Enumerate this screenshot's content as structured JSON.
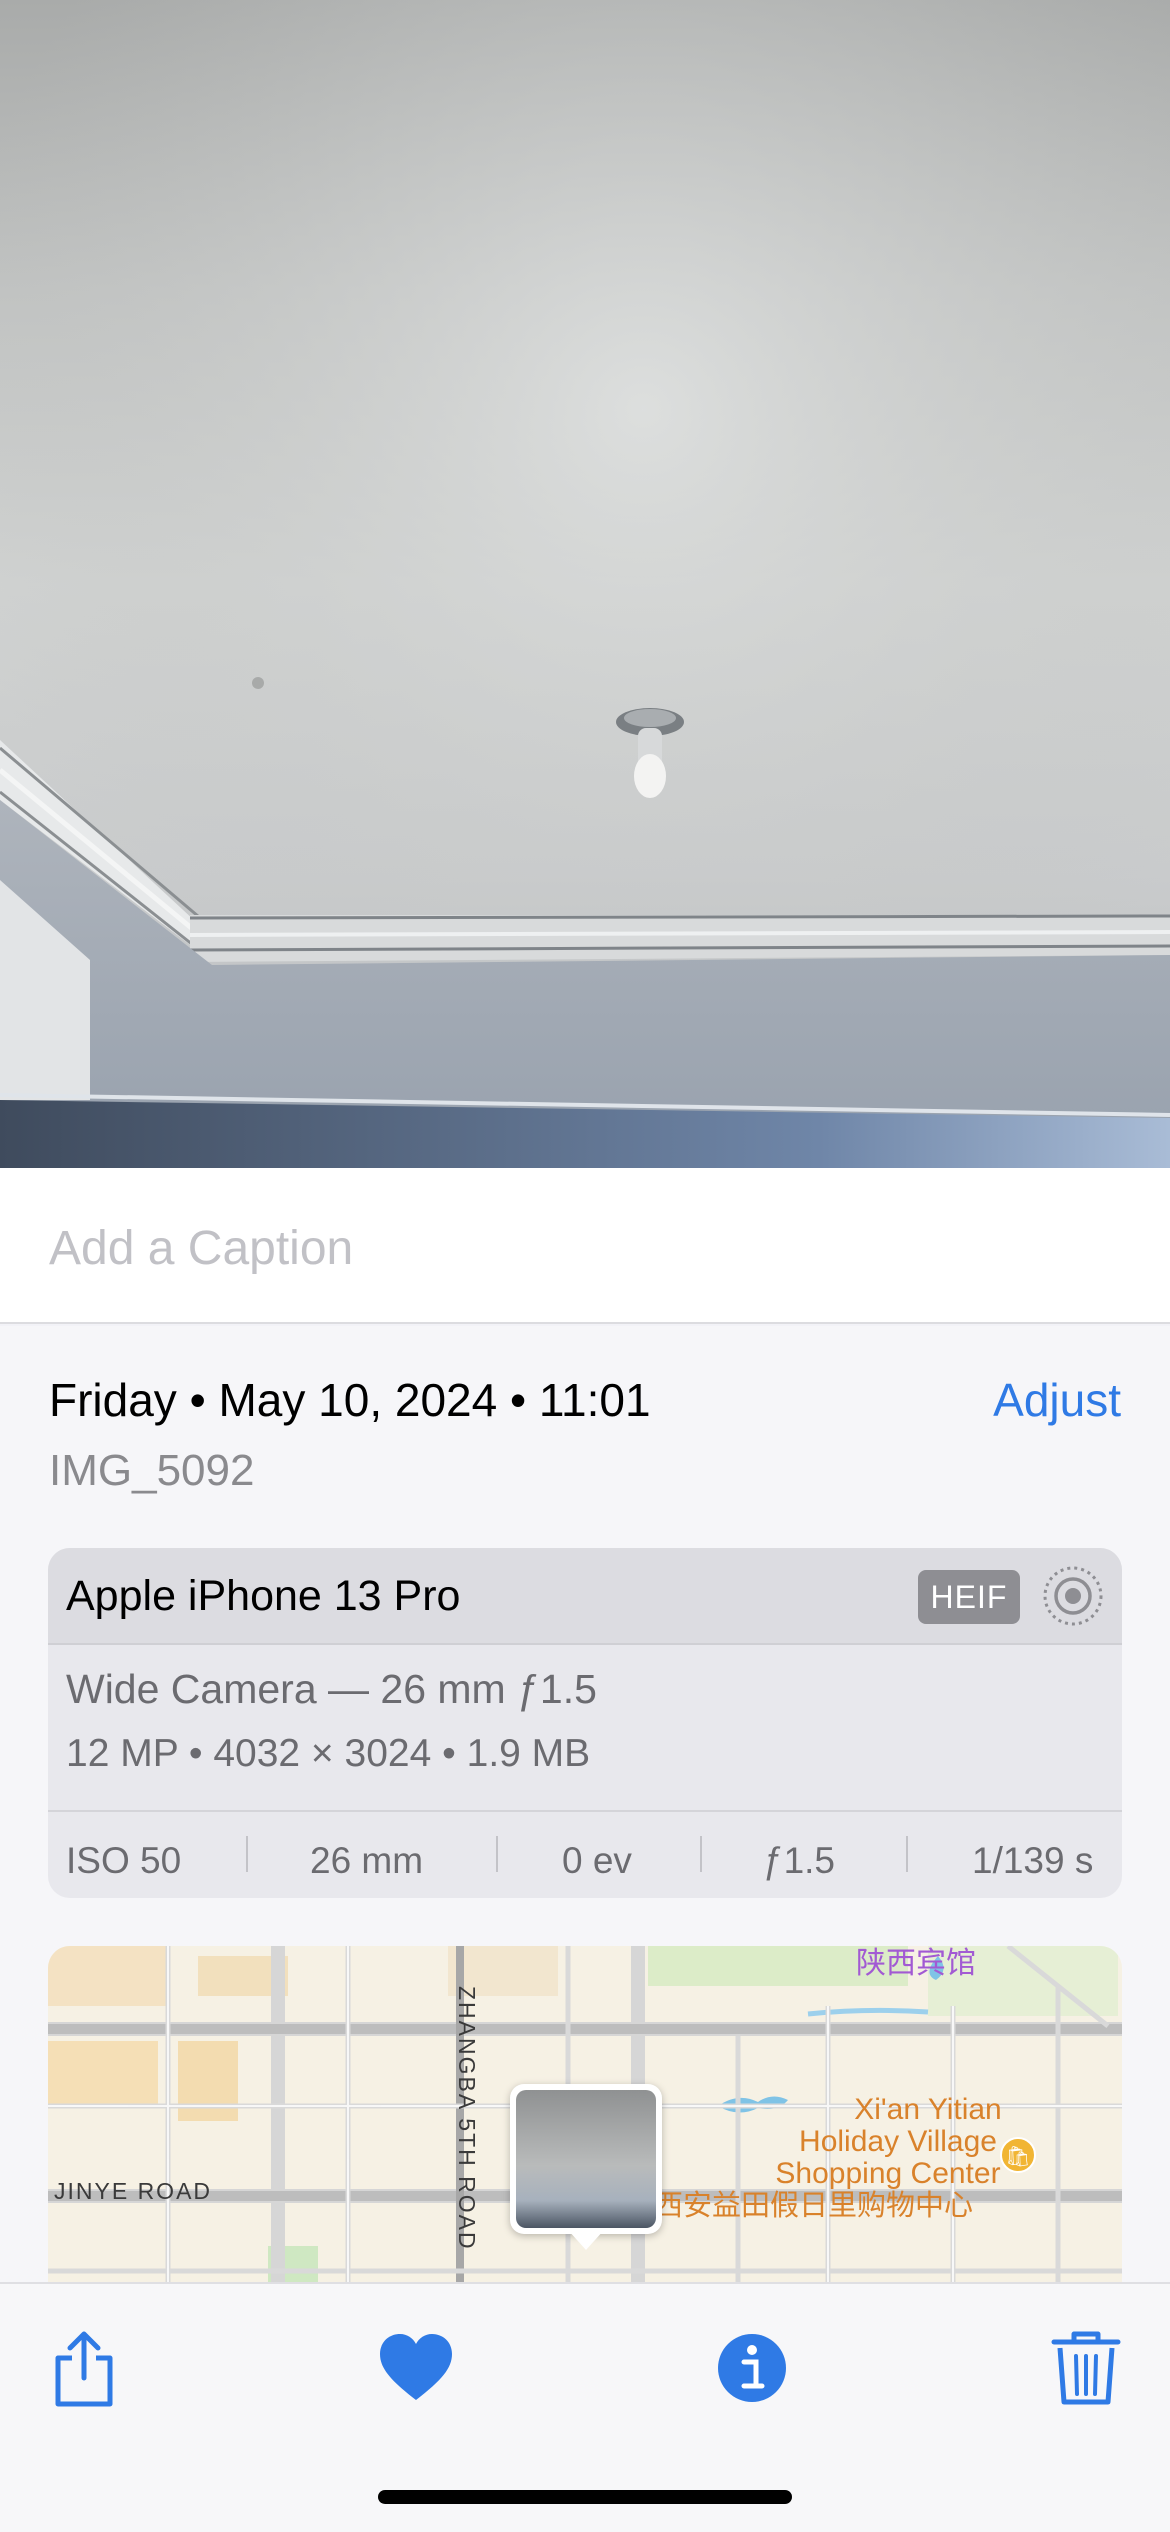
{
  "caption": {
    "placeholder": "Add a Caption"
  },
  "info": {
    "date_line": "Friday • May 10, 2024 • 11:01",
    "adjust_label": "Adjust",
    "filename": "IMG_5092"
  },
  "camera": {
    "device": "Apple iPhone 13 Pro",
    "format_badge": "HEIF",
    "lens": "Wide Camera — 26 mm ƒ1.5",
    "specs": "12 MP  •  4032 × 3024  •  1.9 MB",
    "exif": {
      "iso": "ISO 50",
      "focal_length": "26 mm",
      "exposure_bias": "0 ev",
      "aperture": "ƒ1.5",
      "shutter": "1/139 s"
    },
    "icons": [
      "live-photo-icon"
    ]
  },
  "map": {
    "road_jinye": "JINYE ROAD",
    "road_zhangba": "ZHANGBA 5TH ROAD",
    "poi_en_line1": "Xi'an Yitian",
    "poi_en_line2": "Holiday Village",
    "poi_en_line3": "Shopping Center",
    "poi_cn": "西安益田假日里购物中心",
    "poi_top_partial": "陕西宾馆"
  },
  "toolbar": {
    "icons": [
      "share-icon",
      "favorite-heart-icon",
      "info-icon",
      "trash-icon"
    ]
  },
  "colors": {
    "accent": "#2f7ae5",
    "heart": "#2f7ae5",
    "poi": "#d9822b"
  }
}
